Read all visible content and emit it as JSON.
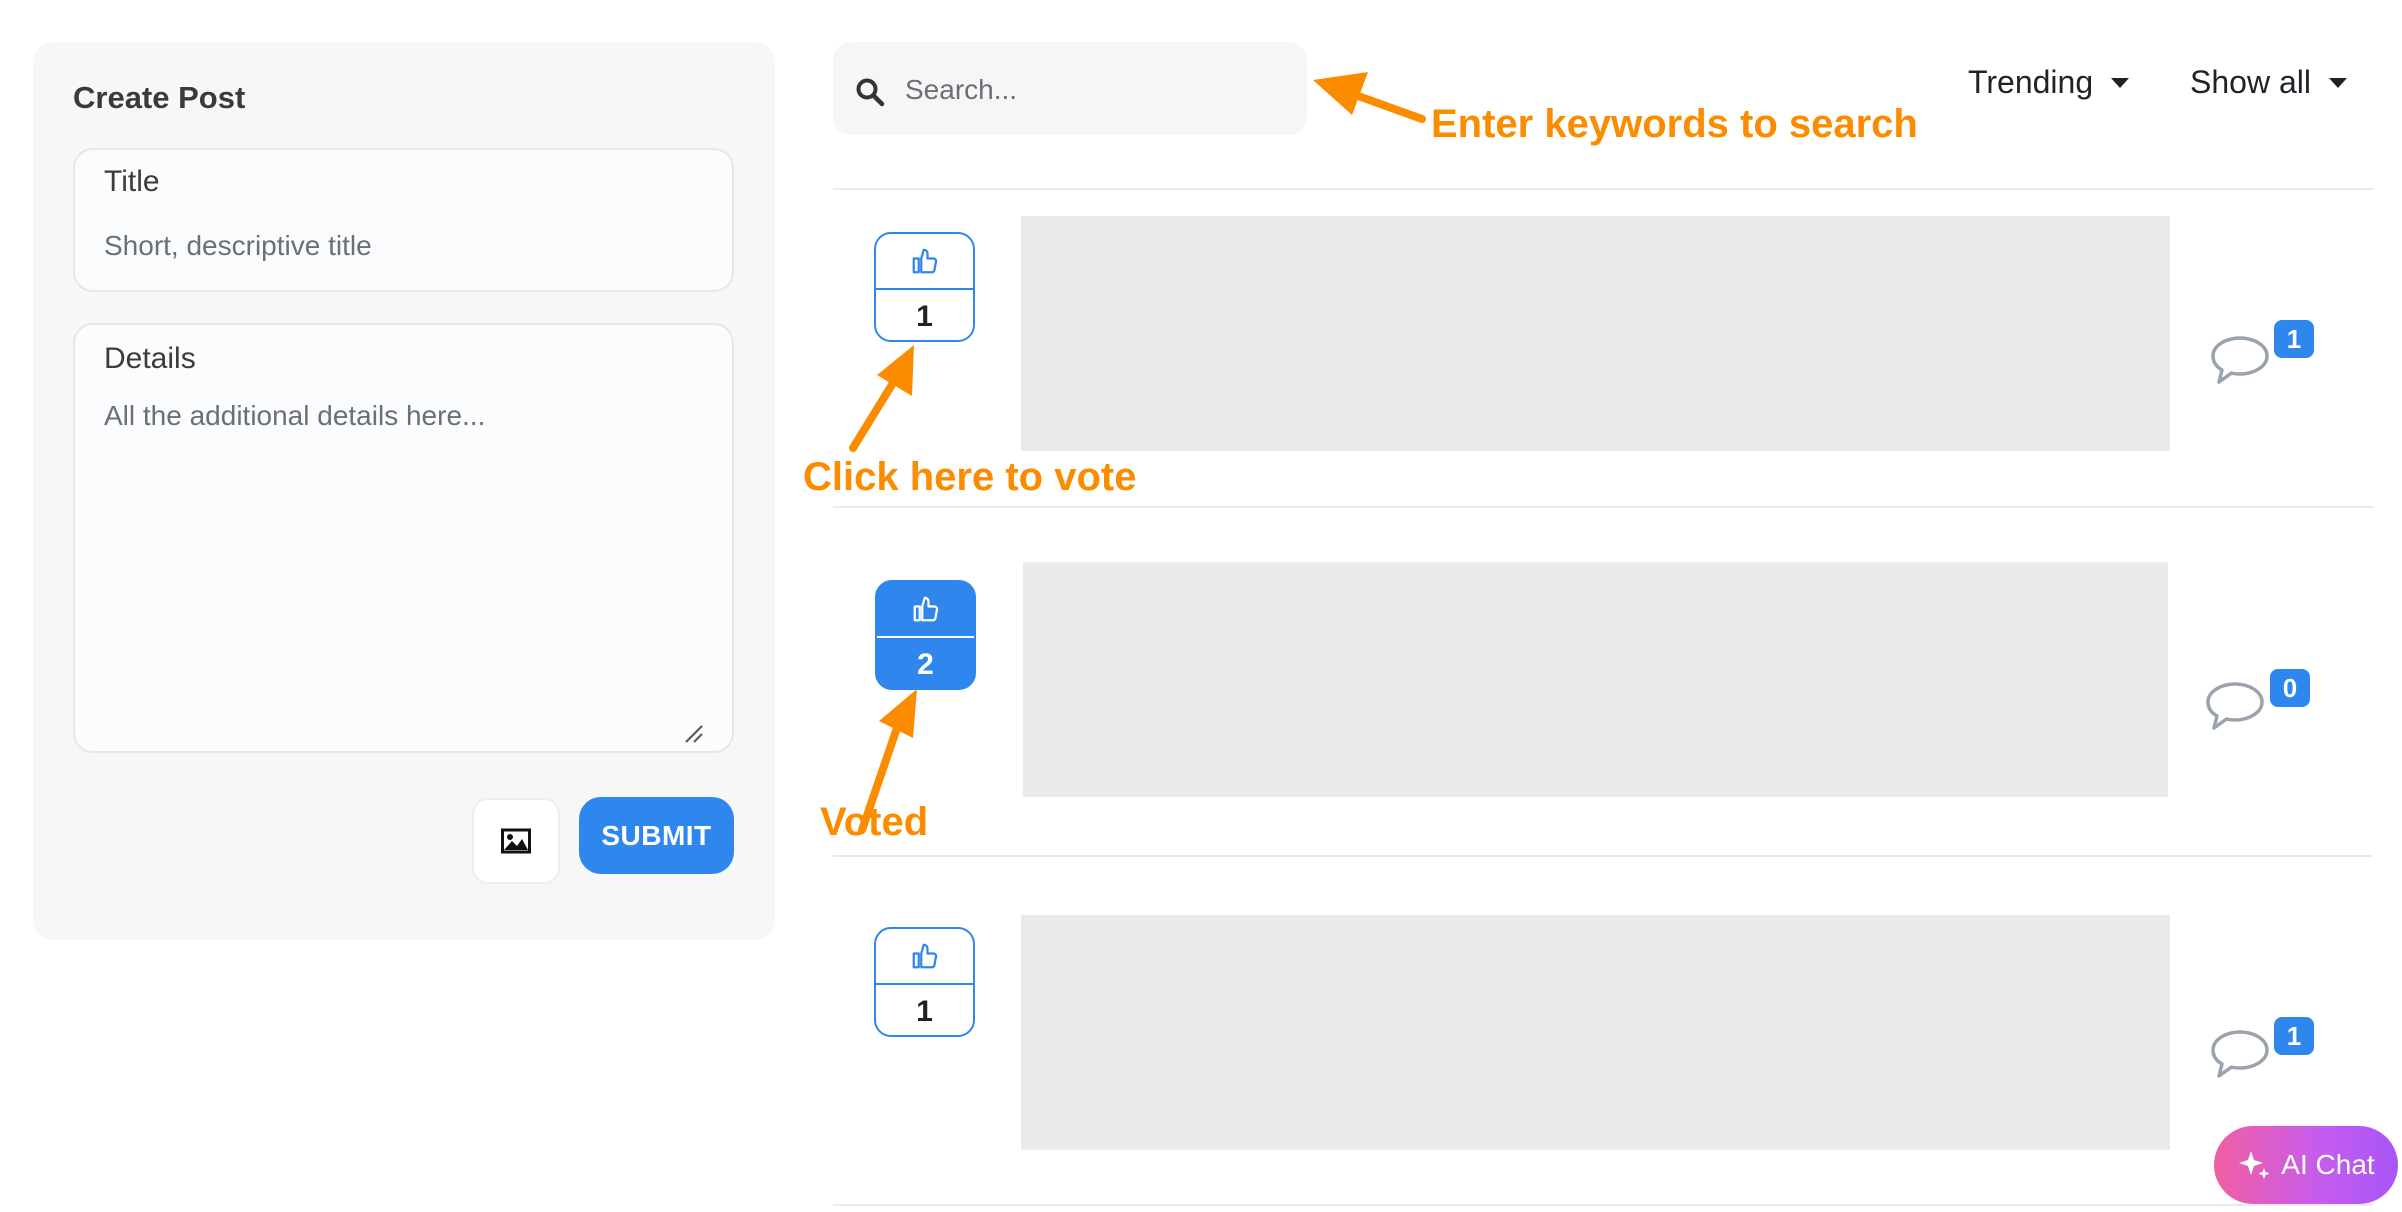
{
  "create_post": {
    "heading": "Create Post",
    "title_label": "Title",
    "title_placeholder": "Short, descriptive title",
    "details_label": "Details",
    "details_placeholder": "All the additional details here...",
    "image_icon": "image-icon",
    "submit_label": "SUBMIT"
  },
  "toolbar": {
    "search_icon": "search-icon",
    "search_placeholder": "Search...",
    "sort_label": "Trending",
    "filter_label": "Show all"
  },
  "posts": [
    {
      "votes": "1",
      "voted": false,
      "comments": "1"
    },
    {
      "votes": "2",
      "voted": true,
      "comments": "0"
    },
    {
      "votes": "1",
      "voted": false,
      "comments": "1"
    }
  ],
  "annotations": {
    "search_hint": "Enter keywords to search",
    "vote_hint": "Click here to vote",
    "voted_hint": "Voted"
  },
  "ai_chat": {
    "label": "AI Chat"
  },
  "colors": {
    "accent": "#2f87ee",
    "annotation": "#fb8c00",
    "placeholder_block": "#eaeaea"
  }
}
